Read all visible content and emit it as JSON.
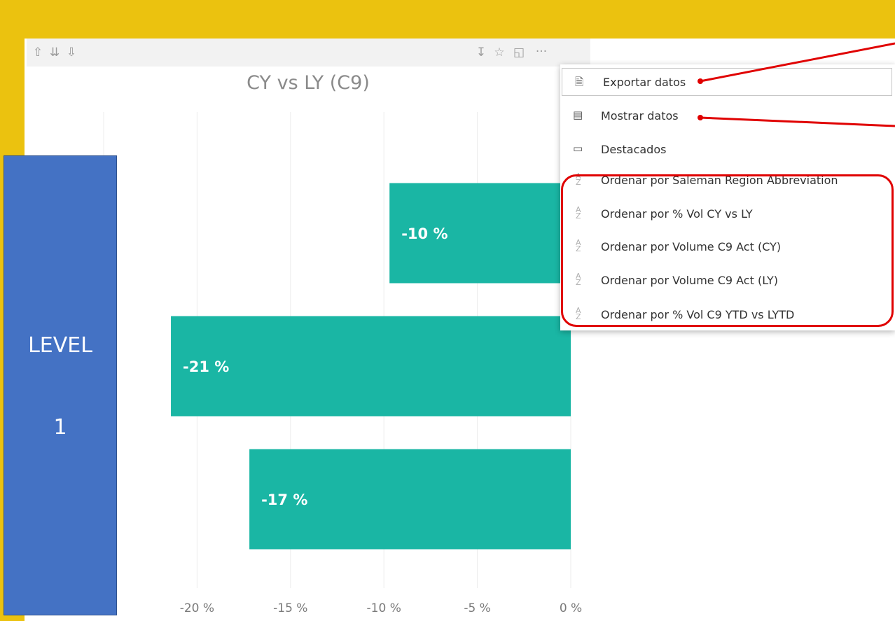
{
  "visual_header": {
    "left_icons": [
      "drill-up-icon",
      "expand-all-down-icon",
      "drill-down-icon"
    ],
    "right_icons": [
      "download-icon",
      "pin-icon",
      "focus-mode-icon",
      "more-options-icon"
    ],
    "more_options_glyph": "···"
  },
  "chart_data": {
    "type": "bar",
    "orientation": "horizontal",
    "title": "CY vs LY (C9)",
    "categories": [
      "",
      "",
      ""
    ],
    "values": [
      -9.7,
      -21.4,
      -17.2
    ],
    "data_labels": [
      "-10 %",
      "-21 %",
      "-17 %"
    ],
    "xlim": [
      -25,
      0
    ],
    "x_ticks": [
      -25,
      -20,
      -15,
      -10,
      -5,
      0
    ],
    "x_tick_labels": [
      "%",
      "-20 %",
      "-15 %",
      "-10 %",
      "-5 %",
      "0 %"
    ],
    "grid": true,
    "bar_color": "#1AB6A4"
  },
  "level_box": {
    "line1": "LEVEL",
    "line2": "1",
    "color": "#4472C4"
  },
  "context_menu": {
    "items": [
      {
        "label": "Exportar datos",
        "icon": "export-data-icon"
      },
      {
        "label": "Mostrar datos",
        "icon": "show-data-icon"
      },
      {
        "label": "Destacados",
        "icon": "spotlight-icon"
      },
      {
        "label": "Ordenar por Saleman Region Abbreviation",
        "icon": "sort-az-icon"
      },
      {
        "label": "Ordenar por % Vol CY vs LY",
        "icon": "sort-az-icon"
      },
      {
        "label": "Ordenar por Volume C9 Act (CY)",
        "icon": "sort-az-icon"
      },
      {
        "label": "Ordenar por Volume C9 Act (LY)",
        "icon": "sort-az-icon"
      },
      {
        "label": "Ordenar por % Vol C9 YTD vs LYTD",
        "icon": "sort-az-icon"
      }
    ]
  },
  "colors": {
    "background": "#EBC20F",
    "annotation": "#E00000"
  }
}
